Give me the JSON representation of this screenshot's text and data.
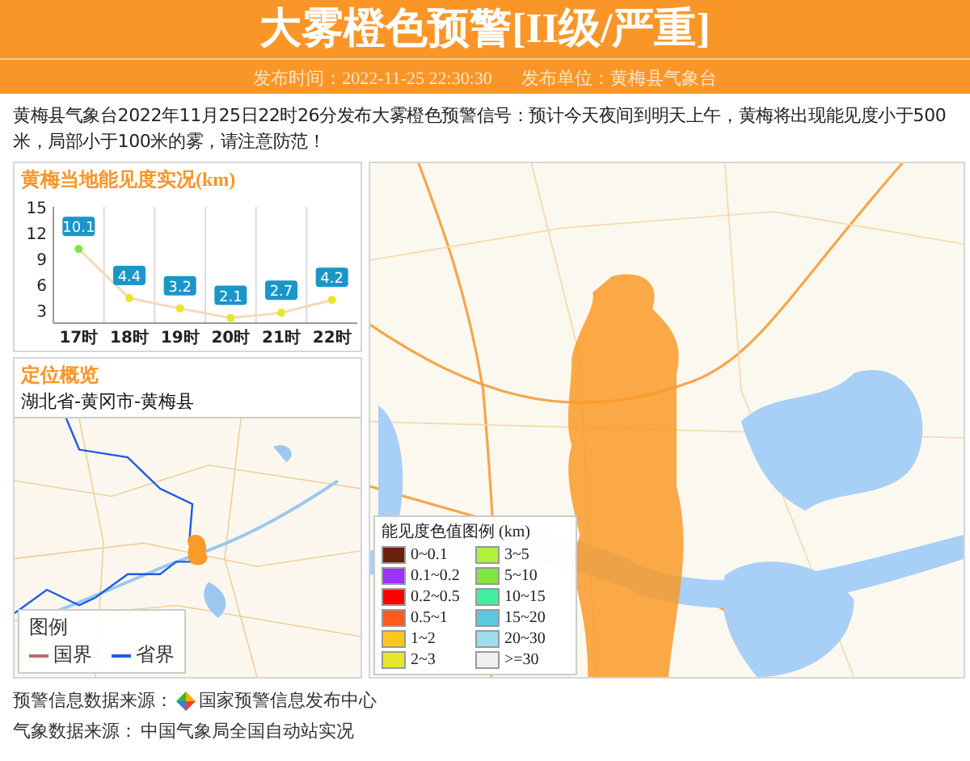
{
  "header": {
    "title": "大雾橙色预警[II级/严重]",
    "publish_time": "发布时间：2022-11-25 22:30:30",
    "publisher": "发布单位：黄梅县气象台"
  },
  "message": "黄梅县气象台2022年11月25日22时26分发布大雾橙色预警信号：预计今天夜间到明天上午，黄梅将出现能见度小于500米，局部小于100米的雾，请注意防范！",
  "visibility_panel": {
    "title": "黄梅当地能见度实况(km)",
    "chart_data": {
      "type": "line",
      "categories": [
        "17时",
        "18时",
        "19时",
        "20时",
        "21时",
        "22时"
      ],
      "series": [
        {
          "color": "#f5d9b8",
          "marker": true,
          "values": [
            10.1,
            4.4,
            3.2,
            2.1,
            2.7,
            4.2
          ]
        }
      ],
      "ylim": [
        1.5,
        15
      ],
      "yticks": [
        3,
        6,
        9,
        12,
        15
      ],
      "data_labels": true
    }
  },
  "location_panel": {
    "title": "定位概览",
    "region": "湖北省-黄冈市-黄梅县",
    "legend": {
      "title": "图例",
      "items": [
        {
          "label": "国界",
          "color": "#c86470"
        },
        {
          "label": "省界",
          "color": "#1a5ce6"
        }
      ]
    }
  },
  "visibility_map": {
    "legend": {
      "title": "能见度色值图例 (km)",
      "items": [
        {
          "label": "0~0.1",
          "color": "#6b1f0a"
        },
        {
          "label": "0.1~0.2",
          "color": "#9b30ff"
        },
        {
          "label": "0.2~0.5",
          "color": "#ff0000"
        },
        {
          "label": "0.5~1",
          "color": "#ff5a1a"
        },
        {
          "label": "1~2",
          "color": "#ffc61a"
        },
        {
          "label": "2~3",
          "color": "#e6e62a"
        },
        {
          "label": "3~5",
          "color": "#b2f03c"
        },
        {
          "label": "5~10",
          "color": "#80e640"
        },
        {
          "label": "10~15",
          "color": "#40f0a0"
        },
        {
          "label": "15~20",
          "color": "#5ac8e0"
        },
        {
          "label": "20~30",
          "color": "#a0dcf0"
        },
        {
          "label": ">=30",
          "color": "#f0f0f0"
        }
      ]
    }
  },
  "sources": [
    {
      "label": "预警信息数据来源：",
      "value": "国家预警信息发布中心",
      "kind": "logo"
    },
    {
      "label": "气象数据来源：",
      "value": "中国气象局全国自动站实况",
      "kind": "plain"
    }
  ]
}
